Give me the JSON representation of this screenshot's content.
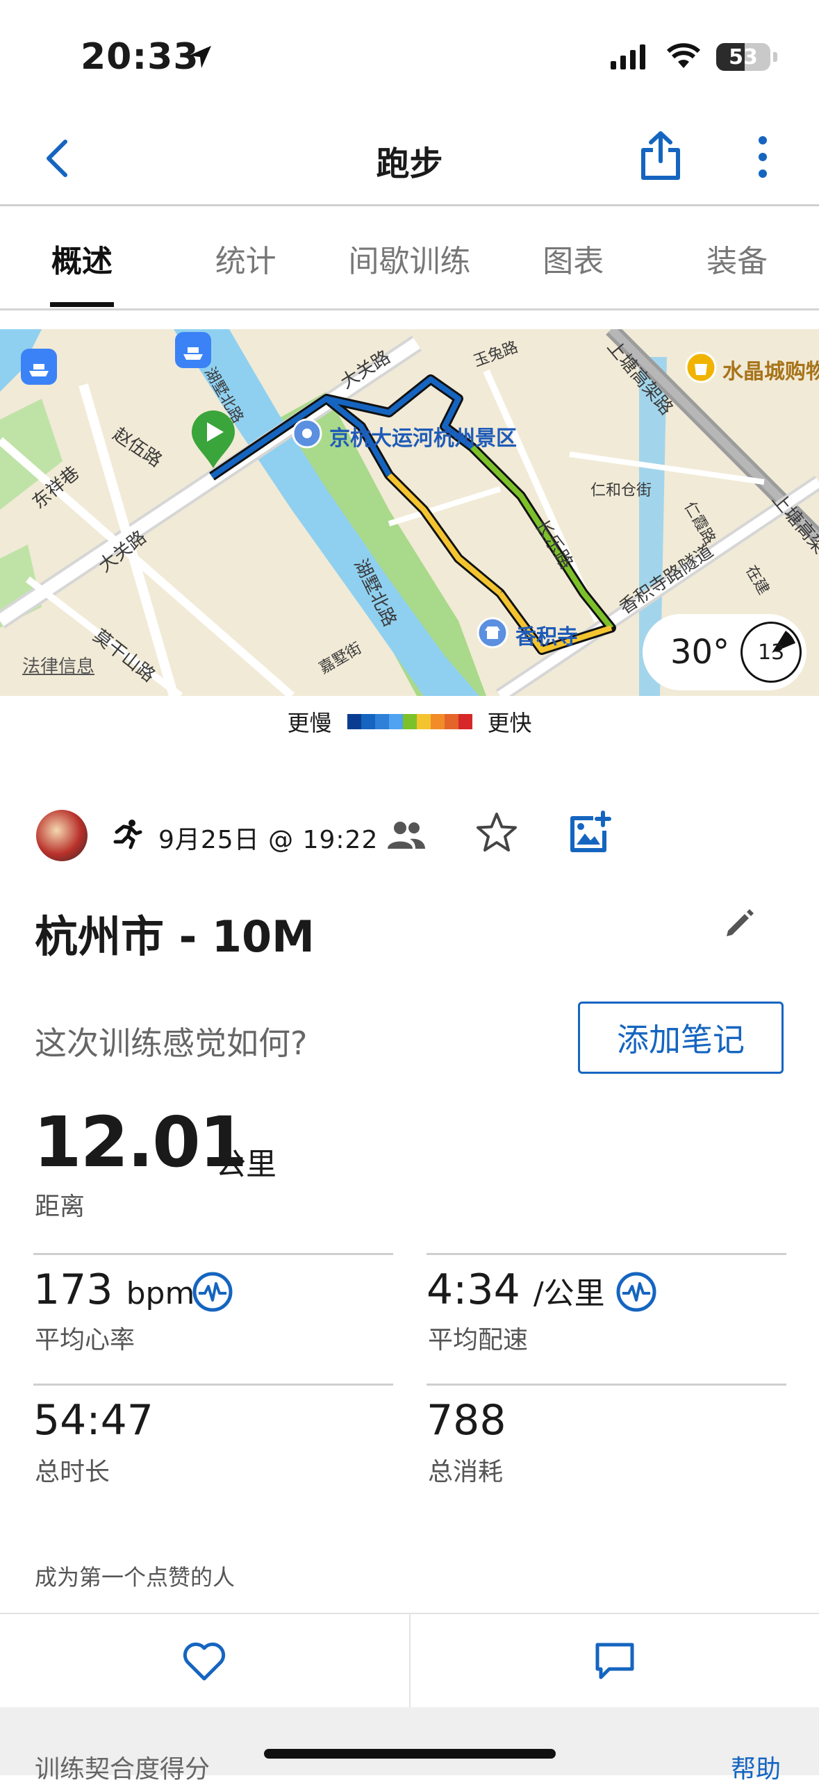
{
  "status": {
    "time": "20:33",
    "battery": "53",
    "battery_level": 0.53
  },
  "header": {
    "title": "跑步"
  },
  "tabs": [
    {
      "label": "概述",
      "active": true
    },
    {
      "label": "统计",
      "active": false
    },
    {
      "label": "间歇训练",
      "active": false
    },
    {
      "label": "图表",
      "active": false
    },
    {
      "label": "装备",
      "active": false
    }
  ],
  "map": {
    "labels": {
      "damao_top": "大关路",
      "zhaowu": "赵伍路",
      "dongxiang": "东祥巷",
      "huxu_top": "湖墅北路",
      "damao_left": "大关路",
      "mogan": "莫干山路",
      "huxu_bottom": "湖墅北路",
      "jiaxin": "嘉墅街",
      "yutu": "玉兔路",
      "shangtang": "上塘高架路",
      "renhe": "仁和仓街",
      "changle": "长乐路",
      "xiangji_tunnel": "香积寺路隧道",
      "renxia": "仁霞路",
      "zaijian": "在建",
      "shangtang_right": "上塘高架"
    },
    "pois": {
      "canal": "京杭大运河杭州景区",
      "temple": "香积寺",
      "mall": "水晶城购物"
    },
    "legal": "法律信息",
    "weather": {
      "temp": "30°",
      "wind": "13"
    }
  },
  "legend": {
    "slow": "更慢",
    "fast": "更快",
    "colors": [
      "#0a3d91",
      "#1565c0",
      "#2f80d8",
      "#4fa3f0",
      "#7cc02a",
      "#f4c430",
      "#f28c28",
      "#e4652a",
      "#d62828"
    ]
  },
  "activity": {
    "date": "9月25日 @ 19:22",
    "title": "杭州市 - 10M",
    "feel_prompt": "这次训练感觉如何?",
    "add_note": "添加笔记"
  },
  "stats": {
    "distance": {
      "value": "12.01",
      "unit": "公里",
      "label": "距离"
    },
    "heart_rate": {
      "value": "173",
      "unit": "bpm",
      "label": "平均心率"
    },
    "pace": {
      "value": "4:34",
      "unit": "/公里",
      "label": "平均配速"
    },
    "duration": {
      "value": "54:47",
      "label": "总时长"
    },
    "calories": {
      "value": "788",
      "label": "总消耗"
    }
  },
  "social": {
    "like_first": "成为第一个点赞的人"
  },
  "footer": {
    "fit_score": "训练契合度得分",
    "help": "帮助"
  },
  "colors": {
    "accent": "#1565c0",
    "route_fast": "#7cc02a",
    "start_pin": "#3aa53a"
  }
}
